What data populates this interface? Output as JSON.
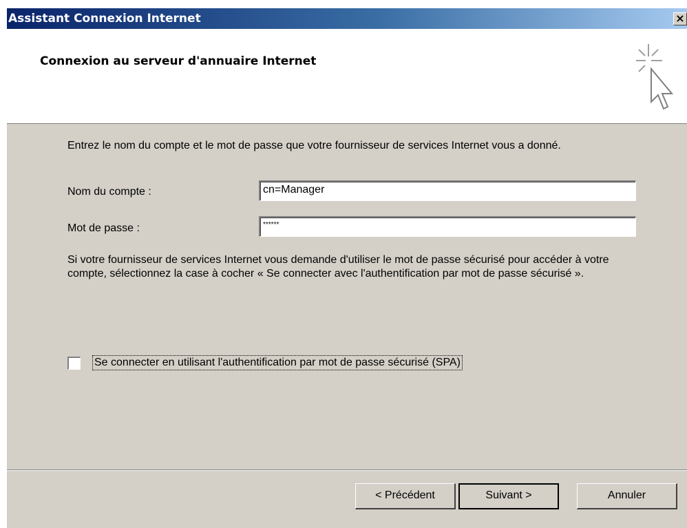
{
  "window": {
    "title": "Assistant Connexion Internet",
    "close_glyph": "×"
  },
  "header": {
    "title": "Connexion au serveur d'annuaire Internet",
    "icon": "wizard-cursor-sparkle-icon"
  },
  "form": {
    "intro_text": "Entrez le nom du compte et le mot de passe que votre fournisseur de services Internet vous a donné.",
    "account_label": "Nom du compte :",
    "account_value": "cn=Manager",
    "password_label": "Mot de passe :",
    "password_value": "******",
    "spa_info_text": "Si votre fournisseur de services Internet vous demande d'utiliser le mot de passe sécurisé pour accéder à votre compte, sélectionnez la case à cocher « Se connecter avec l'authentification par mot de passe sécurisé ».",
    "spa_checkbox_label": "Se connecter en utilisant l'authentification par mot de passe sécurisé (SPA)",
    "spa_checked": false
  },
  "buttons": {
    "back": "< Précédent",
    "next": "Suivant >",
    "cancel": "Annuler"
  },
  "colors": {
    "title_gradient_start": "#0a246a",
    "title_gradient_end": "#a6caf0",
    "dialog_face": "#d4d0c8"
  }
}
